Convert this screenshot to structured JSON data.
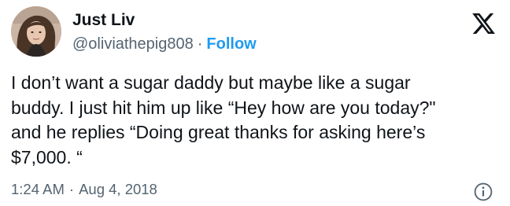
{
  "author": {
    "display_name": "Just Liv",
    "handle": "@oliviathepig808",
    "separator": "·",
    "follow_label": "Follow"
  },
  "tweet": {
    "text": "I don’t want a sugar daddy but maybe like a sugar\nbuddy.  I just hit him up like “Hey how are you today?\"\nand he replies “Doing great thanks for asking here’s\n$7,000. “",
    "time": "1:24 AM",
    "separator": "·",
    "date": "Aug 4, 2018"
  },
  "icons": {
    "platform_logo": "x-logo-icon",
    "info": "info-icon"
  },
  "colors": {
    "link_blue": "#1d9bf0",
    "text_primary": "#0f1419",
    "text_secondary": "#536471"
  }
}
